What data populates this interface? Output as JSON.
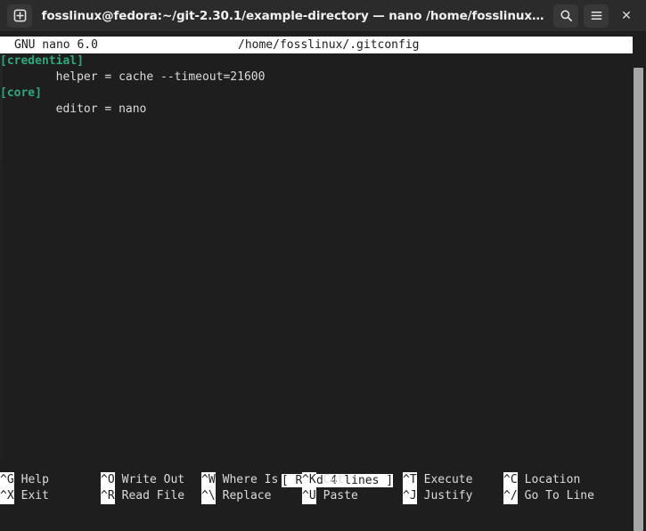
{
  "window": {
    "title": "fosslinux@fedora:~/git-2.30.1/example-directory — nano /home/fosslinux…",
    "new_tab_icon": "plus-square-icon",
    "search_icon": "search-icon",
    "menu_icon": "hamburger-menu-icon",
    "close_label": "✕",
    "colors": {
      "titlebar_bg": "#2b2b2b",
      "terminal_bg": "#1e1e1e",
      "foreground": "#dcdcdc",
      "section_green": "#2fa97c",
      "inverse_bg": "#ffffff",
      "inverse_fg": "#1b1b1b",
      "scrollbar": "#a6a6a6"
    }
  },
  "editor": {
    "header": {
      "version": "GNU nano 6.0",
      "filename": "/home/fosslinux/.gitconfig"
    },
    "lines": [
      {
        "indent": "",
        "section": "[credential]",
        "text": ""
      },
      {
        "indent": "        ",
        "section": "",
        "text": "helper = cache --timeout=21600"
      },
      {
        "indent": "",
        "section": "[core]",
        "text": ""
      },
      {
        "indent": "        ",
        "section": "",
        "text": "editor = nano"
      }
    ],
    "status_message": "[ Read 4 lines ]",
    "shortcuts": [
      {
        "key": "^G",
        "label": "Help",
        "row": 1,
        "col": 0
      },
      {
        "key": "^O",
        "label": "Write Out",
        "row": 1,
        "col": 1
      },
      {
        "key": "^W",
        "label": "Where Is",
        "row": 1,
        "col": 2
      },
      {
        "key": "^K",
        "label": "Cut",
        "row": 1,
        "col": 3
      },
      {
        "key": "^T",
        "label": "Execute",
        "row": 1,
        "col": 4
      },
      {
        "key": "^C",
        "label": "Location",
        "row": 1,
        "col": 5
      },
      {
        "key": "^X",
        "label": "Exit",
        "row": 2,
        "col": 0
      },
      {
        "key": "^R",
        "label": "Read File",
        "row": 2,
        "col": 1
      },
      {
        "key": "^\\",
        "label": "Replace",
        "row": 2,
        "col": 2
      },
      {
        "key": "^U",
        "label": "Paste",
        "row": 2,
        "col": 3
      },
      {
        "key": "^J",
        "label": "Justify",
        "row": 2,
        "col": 4
      },
      {
        "key": "^/",
        "label": "Go To Line",
        "row": 2,
        "col": 5
      }
    ]
  }
}
